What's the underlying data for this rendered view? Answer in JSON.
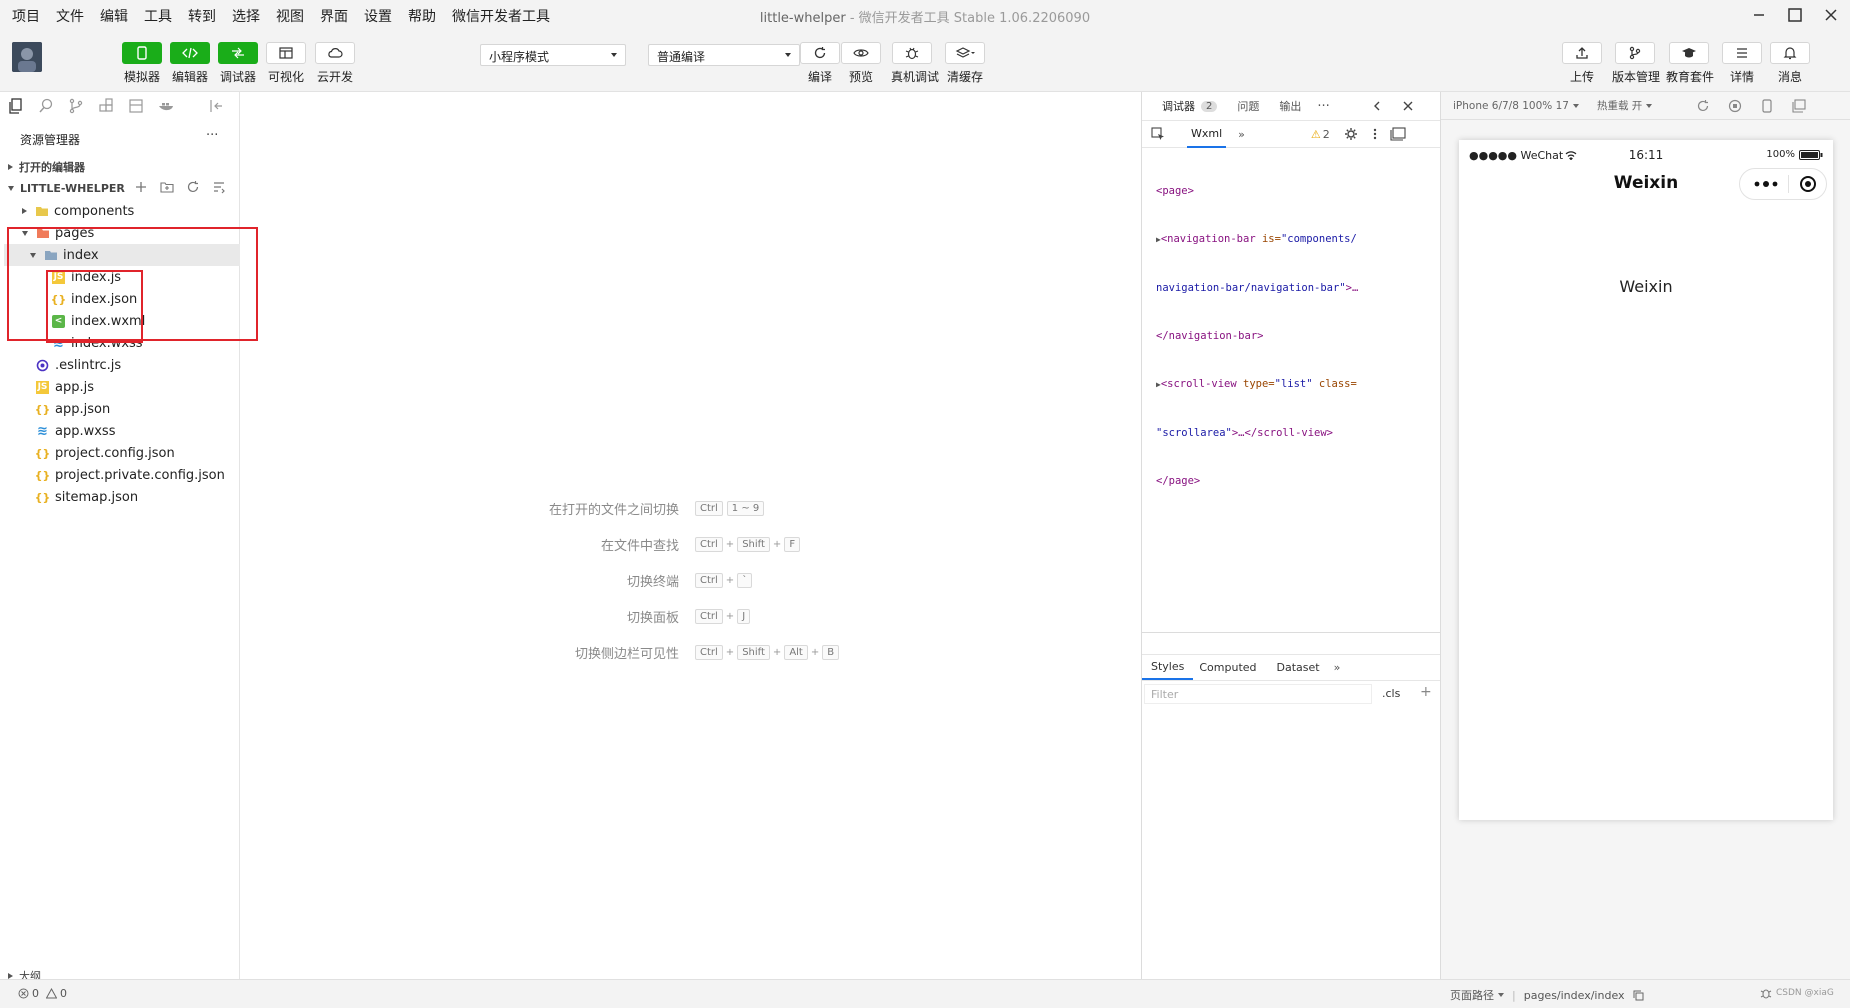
{
  "menu": [
    "项目",
    "文件",
    "编辑",
    "工具",
    "转到",
    "选择",
    "视图",
    "界面",
    "设置",
    "帮助",
    "微信开发者工具"
  ],
  "window": {
    "app_name": "little-whelper",
    "separator": " - ",
    "subtitle": "微信开发者工具 Stable 1.06.2206090"
  },
  "toolbar": {
    "simulator": "模拟器",
    "editor": "编辑器",
    "debugger": "调试器",
    "visual": "可视化",
    "cloud": "云开发",
    "mode_select": "小程序模式",
    "compile_select": "普通编译",
    "compile": "编译",
    "preview": "预览",
    "remote_debug": "真机调试",
    "clear_cache": "清缓存",
    "upload": "上传",
    "version": "版本管理",
    "edu": "教育套件",
    "details": "详情",
    "messages": "消息"
  },
  "explorer": {
    "title": "资源管理器",
    "more": "···",
    "open_editors": "打开的编辑器",
    "project": "LITTLE-WHELPER",
    "tree": {
      "components": "components",
      "pages": "pages",
      "index": "index",
      "index_js": "index.js",
      "index_json": "index.json",
      "index_wxml": "index.wxml",
      "index_wxss": "index.wxss",
      "eslintrc": ".eslintrc.js",
      "app_js": "app.js",
      "app_json": "app.json",
      "app_wxss": "app.wxss",
      "project_config": "project.config.json",
      "project_private": "project.private.config.json",
      "sitemap": "sitemap.json"
    },
    "outline": "大纲"
  },
  "editor": {
    "hints": [
      {
        "label": "在打开的文件之间切换",
        "keys": [
          "Ctrl",
          "1 ~ 9"
        ]
      },
      {
        "label": "在文件中查找",
        "keys": [
          "Ctrl",
          "+",
          "Shift",
          "+",
          "F"
        ]
      },
      {
        "label": "切换终端",
        "keys": [
          "Ctrl",
          "+",
          "`"
        ]
      },
      {
        "label": "切换面板",
        "keys": [
          "Ctrl",
          "+",
          "J"
        ]
      },
      {
        "label": "切换侧边栏可见性",
        "keys": [
          "Ctrl",
          "+",
          "Shift",
          "+",
          "Alt",
          "+",
          "B"
        ]
      }
    ]
  },
  "debugger": {
    "tab_debugger": "调试器",
    "badge": "2",
    "tab_issues": "问题",
    "tab_output": "输出",
    "more": "···",
    "wxml_tab": "Wxml",
    "warn_count": "2",
    "code": {
      "page_open": "<page>",
      "nav_tag": "<navigation-bar",
      "nav_attr": " is=",
      "nav_val1": "\"components/",
      "nav_val2": "navigation-bar/navigation-bar\"",
      "nav_close_ellipsis": ">…",
      "nav_close": "</navigation-bar>",
      "scroll_tag": "<scroll-view",
      "scroll_attr1": " type=",
      "scroll_val1": "\"list\"",
      "scroll_attr2": " class=",
      "scroll_val2": "\"scrollarea\"",
      "scroll_rest": ">…</scroll-view>",
      "page_close": "</page>"
    },
    "styles_tabs": [
      "Styles",
      "Computed",
      "Dataset"
    ],
    "filter_placeholder": "Filter",
    "cls": ".cls",
    "plus": "+"
  },
  "simulator": {
    "device": "iPhone 6/7/8 100% 17",
    "hot_reload": "热重载 开",
    "carrier": "●●●●● WeChat",
    "time": "16:11",
    "battery": "100%",
    "nav_title": "Weixin",
    "body_text": "Weixin"
  },
  "status": {
    "errors": "0",
    "warnings": "0",
    "page_path_label": "页面路径",
    "page_path": "pages/index/index",
    "watermark": "CSDN @xiaG"
  }
}
